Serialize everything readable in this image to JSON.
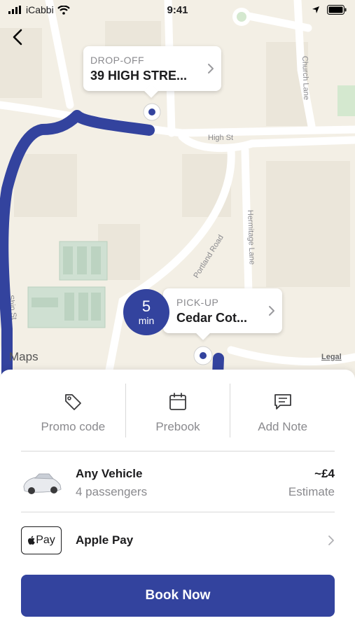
{
  "status_bar": {
    "carrier": "iCabbi",
    "time": "9:41"
  },
  "map": {
    "street_labels": [
      "High St",
      "Church Lane",
      "Hermitage Lane",
      "Portland Road",
      "Ship St"
    ],
    "maps_logo": "Maps",
    "legal": "Legal",
    "route_color": "#33439e"
  },
  "dropoff": {
    "label": "DROP-OFF",
    "address": "39 HIGH STRE..."
  },
  "pickup": {
    "label": "PICK-UP",
    "address": "Cedar Cot...",
    "eta_value": "5",
    "eta_unit": "min"
  },
  "actions": [
    {
      "label": "Promo code",
      "icon": "tag-icon"
    },
    {
      "label": "Prebook",
      "icon": "calendar-icon"
    },
    {
      "label": "Add Note",
      "icon": "message-icon"
    }
  ],
  "vehicle": {
    "name": "Any Vehicle",
    "passengers": "4 passengers",
    "price": "~£4",
    "price_note": "Estimate"
  },
  "payment": {
    "badge": "Pay",
    "name": "Apple Pay"
  },
  "book_button": "Book Now",
  "colors": {
    "accent": "#33439e",
    "map_bg": "#f3efe5"
  }
}
